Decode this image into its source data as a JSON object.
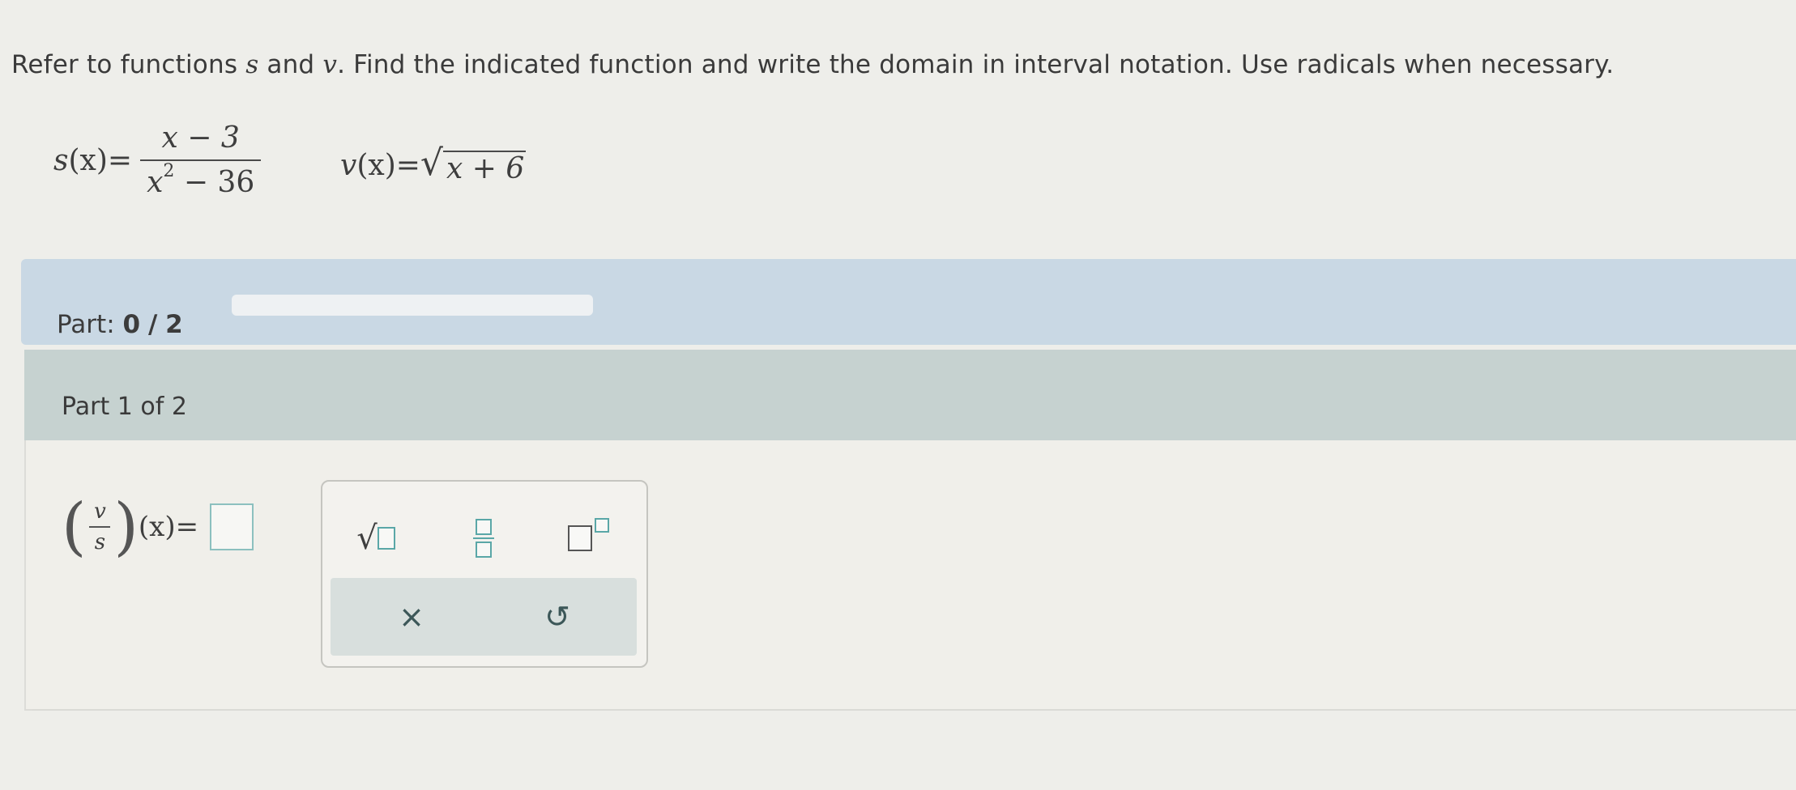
{
  "prompt": {
    "before": "Refer to functions ",
    "var_s": "s",
    "and": " and ",
    "var_v": "v",
    "after": ". Find the indicated function and write the domain in interval notation. Use radicals when necessary."
  },
  "functions": {
    "s": {
      "lhs": "s",
      "arg": "(x)",
      "equals": "=",
      "numerator": "x − 3",
      "denominator_base": "x",
      "denominator_exp": "2",
      "denominator_rest": " − 36"
    },
    "v": {
      "lhs": "v",
      "arg": "(x)",
      "equals": "=",
      "radical": "√",
      "radicand": "x + 6"
    }
  },
  "progress": {
    "label": "Part:",
    "current": "0",
    "separator": "/",
    "total": "2",
    "fraction_complete": 0
  },
  "part": {
    "title": "Part 1 of 2"
  },
  "answer": {
    "numerator": "v",
    "denominator": "s",
    "arg": "(x)",
    "equals": "="
  },
  "toolbar": {
    "sqrt_symbol": "√",
    "clear_symbol": "×",
    "undo_symbol": "↺"
  },
  "colors": {
    "progress_band": "#c9d8e4",
    "part_header": "#c6d2d0",
    "teal_accent": "#5aa7a7",
    "background": "#eeeeea"
  }
}
